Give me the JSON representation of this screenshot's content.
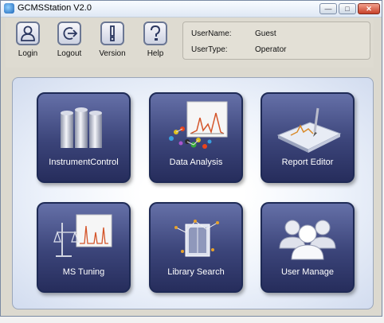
{
  "window": {
    "title": "GCMSStation V2.0"
  },
  "toolbar": {
    "buttons": [
      {
        "label": "Login",
        "icon": "login-icon"
      },
      {
        "label": "Logout",
        "icon": "logout-icon"
      },
      {
        "label": "Version",
        "icon": "version-icon"
      },
      {
        "label": "Help",
        "icon": "help-icon"
      }
    ]
  },
  "user_info": {
    "username_key": "UserName:",
    "username_value": "Guest",
    "usertype_key": "UserType:",
    "usertype_value": "Operator"
  },
  "modules": [
    {
      "label": "InstrumentControl",
      "icon": "instrument-control-icon"
    },
    {
      "label": "Data Analysis",
      "icon": "data-analysis-icon"
    },
    {
      "label": "Report Editor",
      "icon": "report-editor-icon"
    },
    {
      "label": "MS Tuning",
      "icon": "ms-tuning-icon"
    },
    {
      "label": "Library Search",
      "icon": "library-search-icon"
    },
    {
      "label": "User Manage",
      "icon": "user-manage-icon"
    }
  ],
  "colors": {
    "tile_top": "#6570a8",
    "tile_bottom": "#262d5c",
    "panel_background": "#eef3fb"
  }
}
